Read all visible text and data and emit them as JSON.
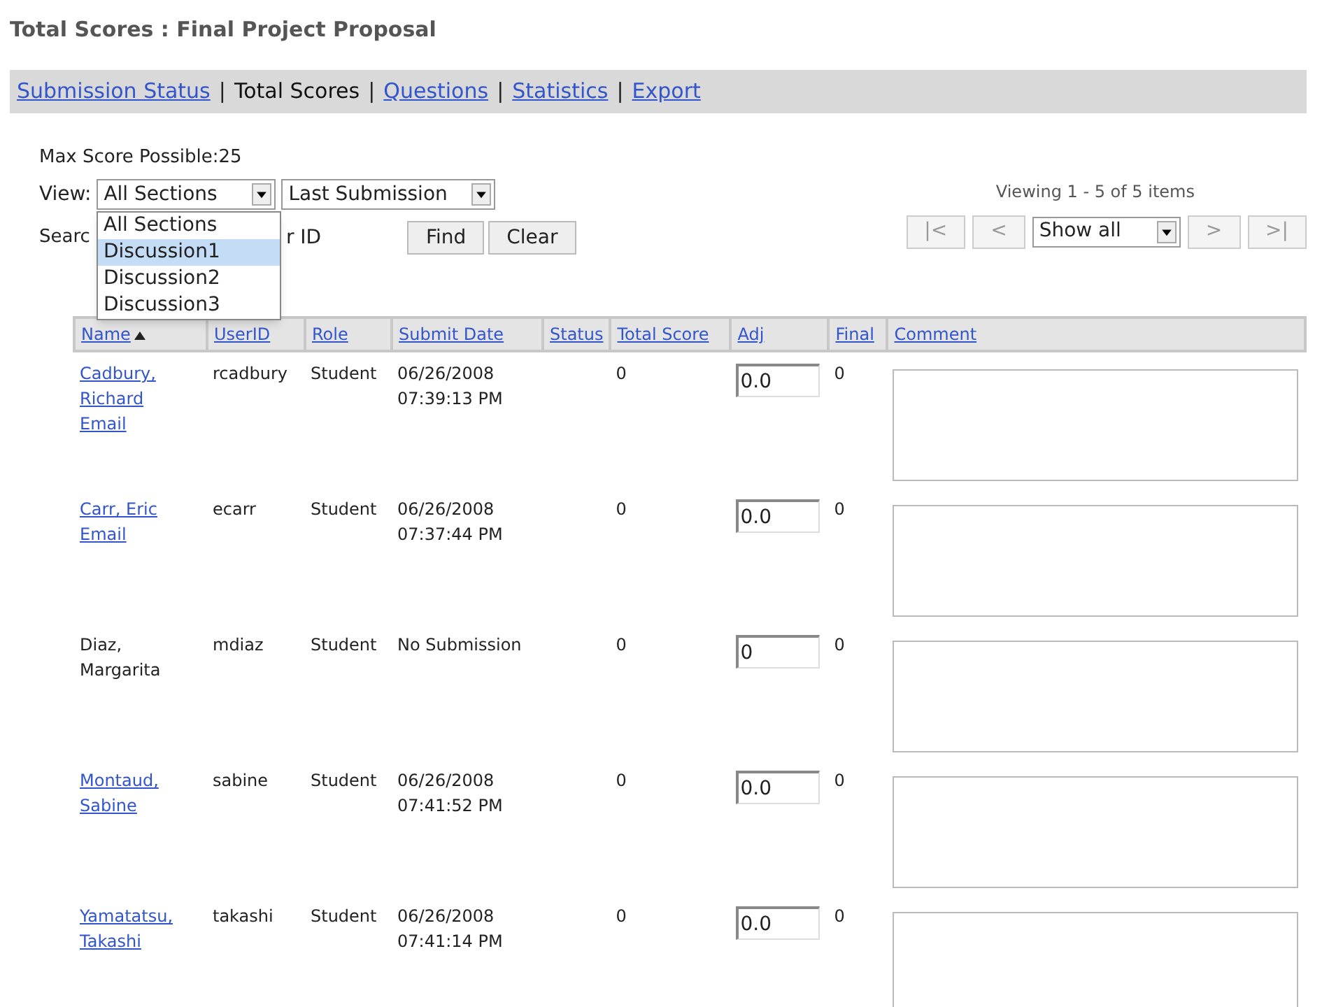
{
  "page_title": "Total Scores : Final Project Proposal",
  "nav": [
    {
      "label": "Submission Status",
      "selected": false
    },
    {
      "label": "Total Scores",
      "selected": true
    },
    {
      "label": "Questions",
      "selected": false
    },
    {
      "label": "Statistics",
      "selected": false
    },
    {
      "label": "Export",
      "selected": false
    }
  ],
  "nav_separator": "|",
  "max_score": "Max Score Possible:25",
  "view": {
    "label": "View:",
    "section_select": "All Sections",
    "submission_select": "Last Submission",
    "section_options": [
      {
        "label": "All Sections",
        "selected": false
      },
      {
        "label": "Discussion1",
        "selected": true
      },
      {
        "label": "Discussion2",
        "selected": false
      },
      {
        "label": "Discussion3",
        "selected": false
      }
    ]
  },
  "search": {
    "label": "Searc",
    "value": "r ID",
    "buttons": [
      "Find",
      "Clear"
    ]
  },
  "paging": {
    "summary": "Viewing 1 - 5 of 5 items",
    "first": "|<",
    "prev": "<",
    "page_size": "Show all",
    "next": ">",
    "last": ">|"
  },
  "table": {
    "columns": [
      {
        "label": "Name",
        "sorted": true
      },
      {
        "label": "UserID",
        "sorted": false
      },
      {
        "label": "Role",
        "sorted": false
      },
      {
        "label": "Submit Date",
        "sorted": false
      },
      {
        "label": "Status",
        "sorted": false
      },
      {
        "label": "Total Score",
        "sorted": false
      },
      {
        "label": "Adj",
        "sorted": false
      },
      {
        "label": "Final",
        "sorted": false
      },
      {
        "label": "Comment",
        "sorted": false
      }
    ],
    "rows": [
      {
        "name": "Cadbury, Richard",
        "linked": true,
        "email": "Email",
        "user_id": "rcadbury",
        "role": "Student",
        "submit_date": "06/26/2008 07:39:13 PM",
        "total": "0",
        "adj": "0.0",
        "final": "0"
      },
      {
        "name": "Carr, Eric",
        "linked": true,
        "email": "Email",
        "user_id": "ecarr",
        "role": "Student",
        "submit_date": "06/26/2008 07:37:44 PM",
        "total": "0",
        "adj": "0.0",
        "final": "0"
      },
      {
        "name": "Diaz, Margarita",
        "linked": false,
        "user_id": "mdiaz",
        "role": "Student",
        "submit_date": "No Submission",
        "total": "0",
        "adj": "0",
        "final": "0"
      },
      {
        "name": "Montaud, Sabine",
        "linked": true,
        "user_id": "sabine",
        "role": "Student",
        "submit_date": "06/26/2008 07:41:52 PM",
        "total": "0",
        "adj": "0.0",
        "final": "0"
      },
      {
        "name": "Yamatatsu, Takashi",
        "linked": true,
        "user_id": "takashi",
        "role": "Student",
        "submit_date": "06/26/2008 07:41:14 PM",
        "total": "0",
        "adj": "0.0",
        "final": "0"
      }
    ]
  }
}
